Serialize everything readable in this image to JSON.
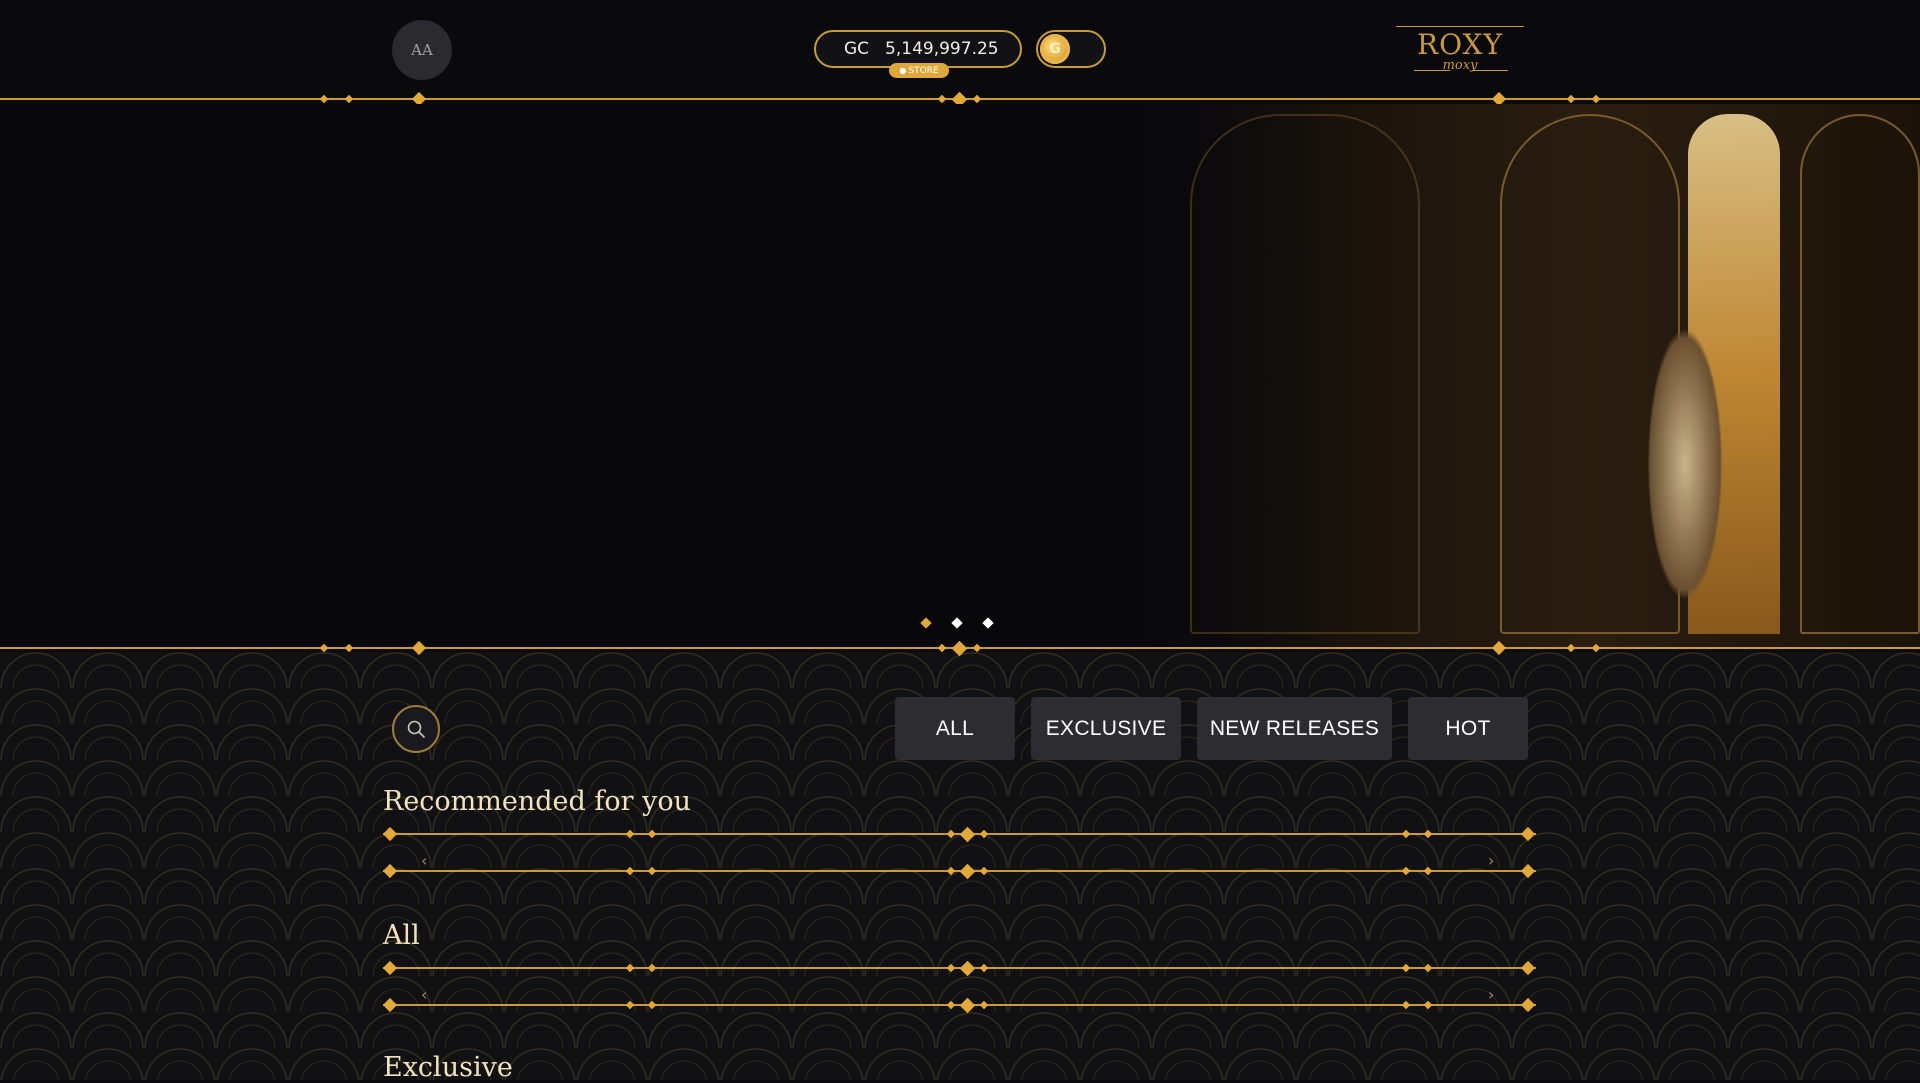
{
  "header": {
    "avatar_initials": "AA",
    "balance_currency": "GC",
    "balance_amount": "5,149,997.25",
    "store_label": "STORE",
    "coin_symbol": "G",
    "logo_main": "ROXY",
    "logo_sub": "moxy"
  },
  "hero": {
    "slides": 3,
    "active_slide": 1
  },
  "filters": [
    "ALL",
    "EXCLUSIVE",
    "NEW RELEASES",
    "HOT"
  ],
  "sections": [
    {
      "title": "Recommended for you"
    },
    {
      "title": "All"
    },
    {
      "title": "Exclusive"
    }
  ],
  "icons": {
    "search": "search-icon",
    "prev": "chevron-left-icon",
    "next": "chevron-right-icon"
  },
  "colors": {
    "accent_gold": "#c99a39",
    "diamond_gold": "#e2a83a",
    "background": "#0a0a0d",
    "button_bg": "#2c2c31",
    "title_text": "#f3e2bf"
  }
}
